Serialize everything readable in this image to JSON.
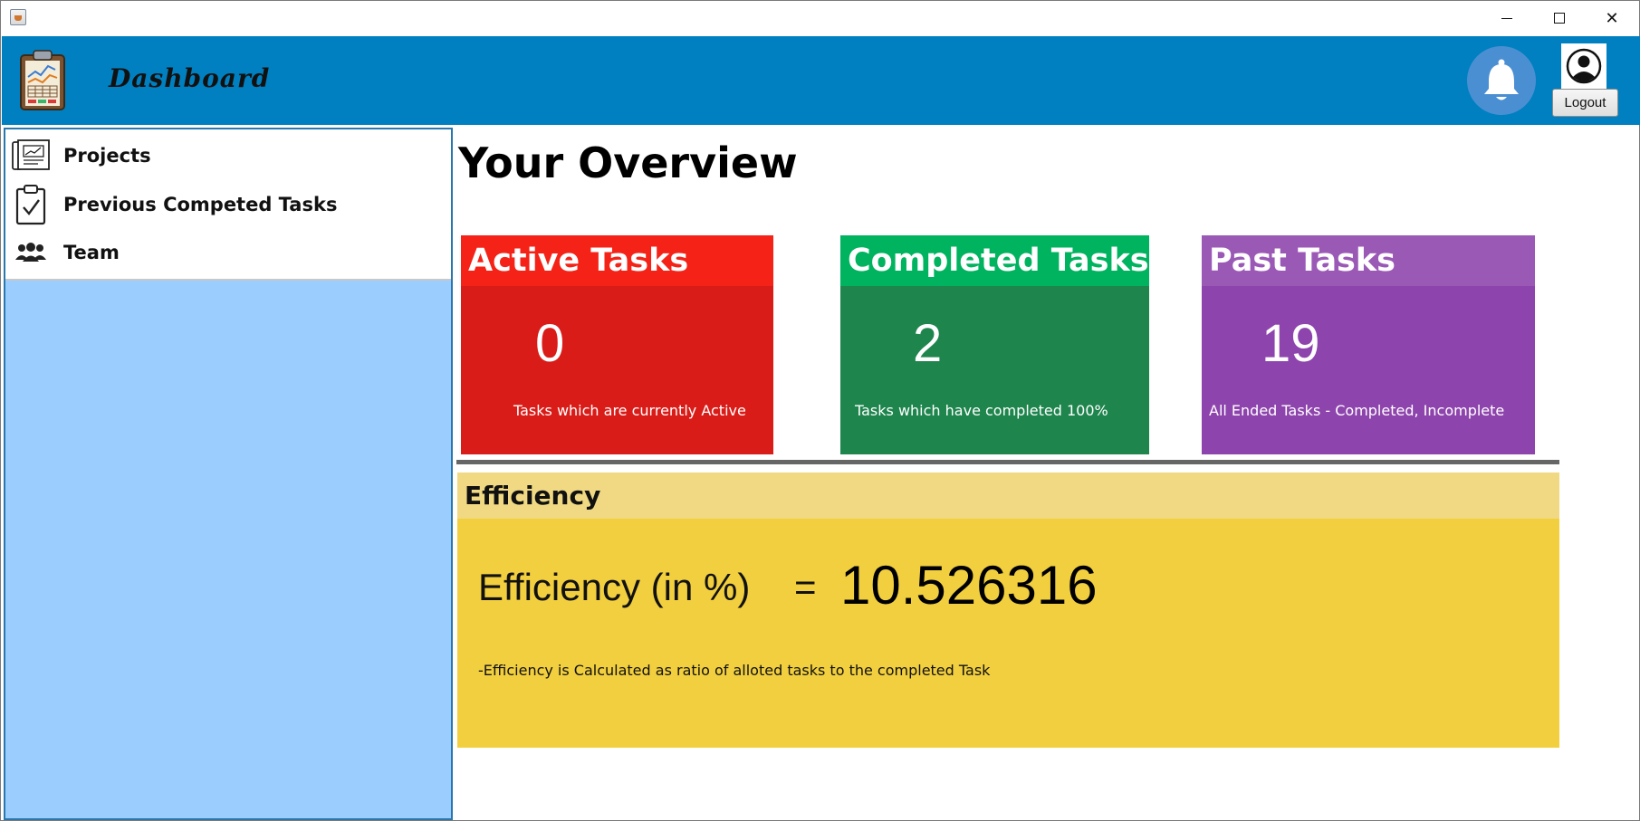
{
  "window": {
    "title": "",
    "minimize_icon": "minimize-icon",
    "maximize_icon": "maximize-icon",
    "close_symbol": "✕"
  },
  "header": {
    "title": "Dashboard",
    "logo_icon": "clipboard-chart-icon",
    "bell_icon": "bell-icon",
    "user_icon": "user-icon",
    "logout_label": "Logout",
    "bg_color": "#0080c0"
  },
  "sidebar": {
    "items": [
      {
        "label": "Projects",
        "icon": "projects-chart-icon"
      },
      {
        "label": "Previous Competed Tasks",
        "icon": "clipboard-check-icon"
      },
      {
        "label": "Team",
        "icon": "team-icon"
      }
    ],
    "panel_color": "#9ccdff"
  },
  "main": {
    "title": "Your Overview",
    "cards": {
      "active": {
        "title": "Active Tasks",
        "value": "0",
        "description": "Tasks which are currently Active",
        "head_color": "#f42217",
        "body_color": "#da1c18"
      },
      "completed": {
        "title": "Completed Tasks",
        "value": "2",
        "description": "Tasks which have completed 100%",
        "head_color": "#00b35f",
        "body_color": "#1e854d"
      },
      "past": {
        "title": "Past Tasks",
        "value": "19",
        "description": "All Ended Tasks - Completed, Incomplete",
        "head_color": "#9b59b6",
        "body_color": "#8e44ad"
      }
    },
    "efficiency": {
      "title": "Efficiency",
      "label": "Efficiency (in %)",
      "equals": "=",
      "value": "10.526316",
      "note": "-Efficiency is Calculated as ratio of alloted tasks to the completed Task",
      "head_color": "#f0d982",
      "body_color": "#f2cf3e"
    }
  }
}
